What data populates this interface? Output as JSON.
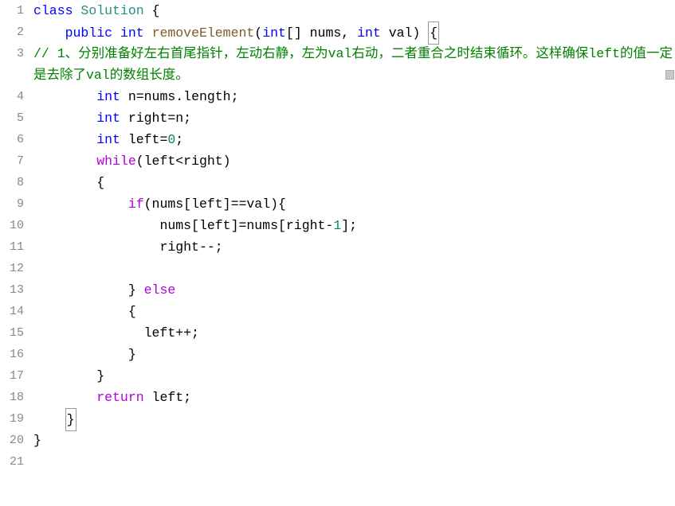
{
  "gutter": {
    "lines": [
      "1",
      "2",
      "3",
      "4",
      "5",
      "6",
      "7",
      "8",
      "9",
      "10",
      "11",
      "12",
      "13",
      "14",
      "15",
      "16",
      "17",
      "18",
      "19",
      "20",
      "21"
    ]
  },
  "code": {
    "l1": {
      "class_kw": "class",
      "class_name": "Solution",
      "brace": "{"
    },
    "l2": {
      "public": "public",
      "int": "int",
      "method": "removeElement",
      "p": "(",
      "int_arr": "int",
      "arr": "[]",
      "nums": "nums",
      "comma": ",",
      "int2": "int",
      "val": "val",
      "rp": ")",
      "brace": "{"
    },
    "l3": {
      "comment_prefix": "// ",
      "one": "1",
      "txt1": "、分别准备好左右首尾指针，左动右静，左为",
      "val": "val",
      "txt2": "右动，二者重合之时结束循环。这样确保",
      "left": "left",
      "txt3": "的值一定是去除了",
      "val2": "val",
      "txt4": "的数组长度。"
    },
    "l4": {
      "int": "int",
      "var": "n",
      "eq": "=",
      "nums": "nums",
      "dot": ".",
      "length": "length",
      "semi": ";"
    },
    "l5": {
      "int": "int",
      "var": "right",
      "eq": "=",
      "val": "n",
      "semi": ";"
    },
    "l6": {
      "int": "int",
      "var": "left",
      "eq": "=",
      "val": "0",
      "semi": ";"
    },
    "l7": {
      "while": "while",
      "lp": "(",
      "left": "left",
      "lt": "<",
      "right": "right",
      "rp": ")"
    },
    "l8": {
      "brace": "{"
    },
    "l9": {
      "if": "if",
      "lp": "(",
      "nums": "nums",
      "lbr": "[",
      "left": "left",
      "rbr": "]",
      "eq": "==",
      "val": "val",
      "rp": ")",
      "brace": "{"
    },
    "l10": {
      "nums": "nums",
      "lbr": "[",
      "left": "left",
      "rbr": "]",
      "eq": "=",
      "nums2": "nums",
      "lbr2": "[",
      "right": "right",
      "minus": "-",
      "one": "1",
      "rbr2": "]",
      "semi": ";"
    },
    "l11": {
      "right": "right",
      "dec": "--",
      "semi": ";"
    },
    "l12": {
      "empty": ""
    },
    "l13": {
      "rbrace": "}",
      "else": "else"
    },
    "l14": {
      "brace": "{"
    },
    "l15": {
      "left": "left",
      "inc": "++",
      "semi": ";"
    },
    "l16": {
      "rbrace": "}"
    },
    "l17": {
      "rbrace": "}"
    },
    "l18": {
      "return": "return",
      "left": "left",
      "semi": ";"
    },
    "l19": {
      "rbrace": "}"
    },
    "l20": {
      "rbrace": "}"
    },
    "l21": {
      "empty": ""
    }
  }
}
